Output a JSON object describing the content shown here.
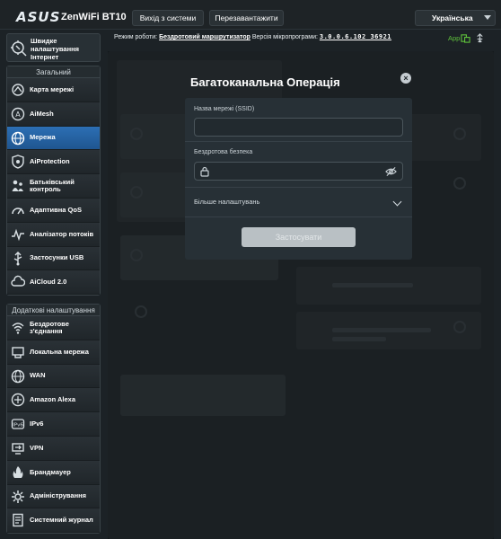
{
  "header": {
    "logo": "ASUS",
    "model": "ZenWiFi BT10",
    "logout_label": "Вихід з системи",
    "reboot_label": "Перезавантажити",
    "language": "Українська"
  },
  "infobar": {
    "mode_label": "Режим роботи:",
    "mode_value": "Бездротовий маршрутизатор",
    "fw_label": "Версія мікропрограми:",
    "fw_value": "3.0.0.6.102_36921",
    "app_label": "App"
  },
  "sidebar": {
    "quick_setup": "Швидке налаштування Інтернет",
    "general_title": "Загальний",
    "general_items": [
      {
        "label": "Карта мережі",
        "icon": "network-map-icon",
        "active": false
      },
      {
        "label": "AiMesh",
        "icon": "aimesh-icon",
        "active": false
      },
      {
        "label": "Мережа",
        "icon": "globe-network-icon",
        "active": true
      },
      {
        "label": "AiProtection",
        "icon": "shield-icon",
        "active": false
      },
      {
        "label": "Батьківський контроль",
        "icon": "parental-control-icon",
        "active": false
      },
      {
        "label": "Адаптивна QoS",
        "icon": "qos-gauge-icon",
        "active": false
      },
      {
        "label": "Аналізатор потоків",
        "icon": "traffic-analyzer-icon",
        "active": false
      },
      {
        "label": "Застосунки USB",
        "icon": "usb-icon",
        "active": false
      },
      {
        "label": "AiCloud 2.0",
        "icon": "cloud-icon",
        "active": false
      }
    ],
    "advanced_title": "Додаткові налаштування",
    "advanced_items": [
      {
        "label": "Бездротове з'єднання",
        "icon": "wireless-icon"
      },
      {
        "label": "Локальна мережа",
        "icon": "lan-icon"
      },
      {
        "label": "WAN",
        "icon": "wan-globe-icon"
      },
      {
        "label": "Amazon Alexa",
        "icon": "alexa-icon"
      },
      {
        "label": "IPv6",
        "icon": "ipv6-icon"
      },
      {
        "label": "VPN",
        "icon": "vpn-icon"
      },
      {
        "label": "Брандмауер",
        "icon": "firewall-icon"
      },
      {
        "label": "Адміністрування",
        "icon": "admin-gear-icon"
      },
      {
        "label": "Системний журнал",
        "icon": "system-log-icon"
      }
    ]
  },
  "modal": {
    "title": "Багатоканальна Операція",
    "ssid_label": "Назва мережі (SSID)",
    "ssid_value": "",
    "security_label": "Бездротова безпека",
    "security_value": "",
    "more_settings": "Більше налаштувань",
    "apply_label": "Застосувати"
  },
  "colors": {
    "active_item": "#2a6db0",
    "app_green": "#5fc23b",
    "apply_disabled": "#b9c0c4"
  }
}
